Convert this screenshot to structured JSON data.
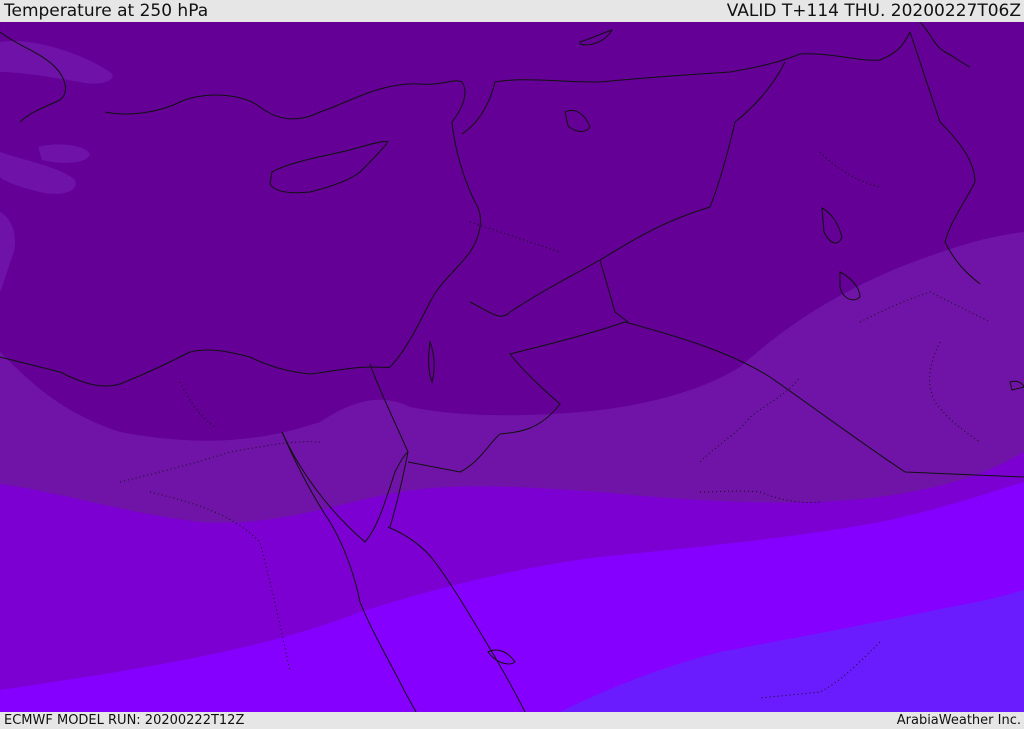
{
  "header": {
    "title": "Temperature at 250 hPa",
    "valid_time": "VALID T+114 THU. 20200227T06Z"
  },
  "footer": {
    "model_run": "ECMWF MODEL RUN: 20200222T12Z",
    "credit": "ArabiaWeather Inc."
  },
  "map": {
    "colors": {
      "band_1": "#640096",
      "band_2": "#7014a8",
      "band_3": "#7c00d2",
      "band_4": "#8600ff",
      "band_5": "#6a1cff",
      "coastline": "#111111"
    }
  }
}
